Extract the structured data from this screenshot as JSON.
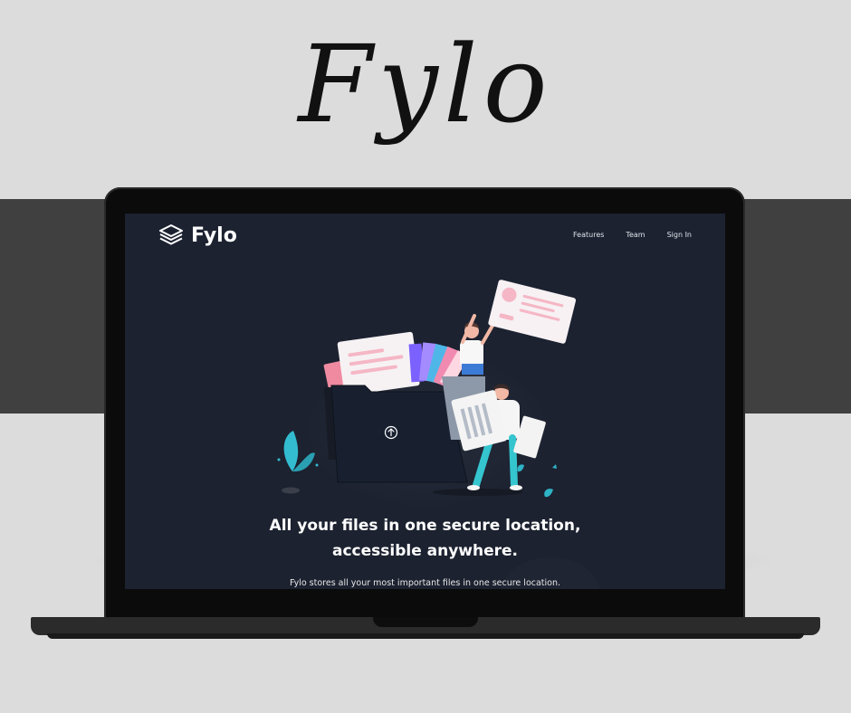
{
  "banner": {
    "title": "Fylo"
  },
  "site": {
    "logo_text": "Fylo",
    "nav": [
      {
        "label": "Features"
      },
      {
        "label": "Team"
      },
      {
        "label": "Sign In"
      }
    ],
    "hero": {
      "headline_line1": "All your files in one secure location,",
      "headline_line2": "accessible anywhere.",
      "subtext": "Fylo stores all your most important files in one secure location."
    }
  },
  "colors": {
    "page_bg": "#dcdcdc",
    "band": "#404040",
    "screen_bg": "#1c2230",
    "accent_pink": "#f4a6b5",
    "accent_cyan": "#38c4d4"
  },
  "icons": [
    "stacked-layers-logo-icon",
    "upload-arrow-icon"
  ]
}
